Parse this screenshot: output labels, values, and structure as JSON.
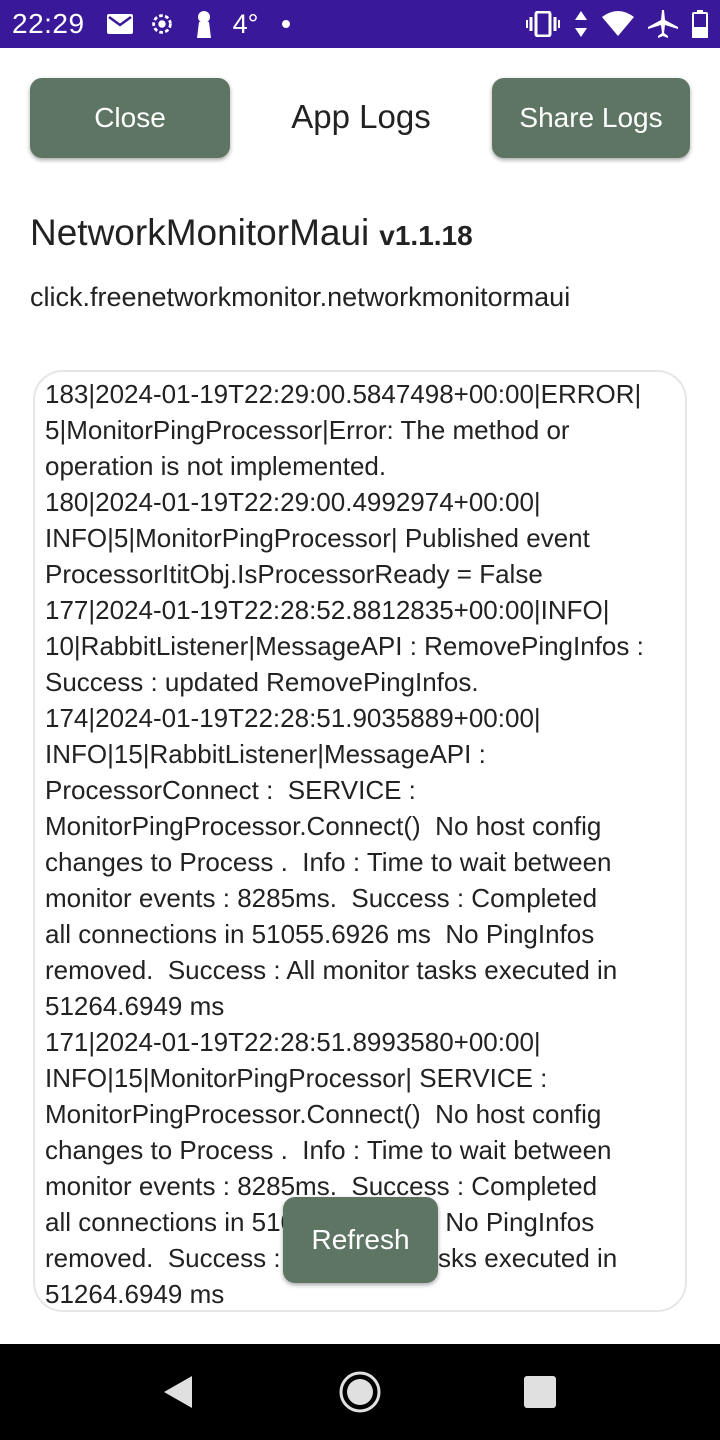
{
  "status_bar": {
    "time": "22:29",
    "temperature": "4°",
    "left_icons": [
      "mail-icon",
      "settings-cog-icon",
      "keyhole-icon"
    ],
    "right_icons": [
      "vibrate-icon",
      "data-arrows-icon",
      "wifi-icon",
      "airplane-icon",
      "battery-icon"
    ],
    "background_color": "#3a189a"
  },
  "header": {
    "close_label": "Close",
    "title": "App Logs",
    "share_label": "Share Logs",
    "button_color": "#5e7563"
  },
  "app_info": {
    "name": "NetworkMonitorMaui",
    "version": "v1.1.18",
    "package": "click.freenetworkmonitor.networkmonitormaui"
  },
  "logs": {
    "text": "183|2024-01-19T22:29:00.5847498+00:00|ERROR|\n5|MonitorPingProcessor|Error: The method or\noperation is not implemented.\n180|2024-01-19T22:29:00.4992974+00:00|\nINFO|5|MonitorPingProcessor| Published event\nProcessorItitObj.IsProcessorReady = False\n177|2024-01-19T22:28:52.8812835+00:00|INFO|\n10|RabbitListener|MessageAPI : RemovePingInfos :\nSuccess : updated RemovePingInfos.\n174|2024-01-19T22:28:51.9035889+00:00|\nINFO|15|RabbitListener|MessageAPI :\nProcessorConnect :  SERVICE :\nMonitorPingProcessor.Connect()  No host config\nchanges to Process .  Info : Time to wait between\nmonitor events : 8285ms.  Success : Completed\nall connections in 51055.6926 ms  No PingInfos\nremoved.  Success : All monitor tasks executed in\n51264.6949 ms\n171|2024-01-19T22:28:51.8993580+00:00|\nINFO|15|MonitorPingProcessor| SERVICE :\nMonitorPingProcessor.Connect()  No host config\nchanges to Process .  Info : Time to wait between\nmonitor events : 8285ms.  Success : Completed\nall connections in 51055.6926 ms  No PingInfos\nremoved.  Success : All monitor tasks executed in\n51264.6949 ms"
  },
  "refresh_label": "Refresh",
  "nav_bar": {
    "icons": [
      "back-icon",
      "home-icon",
      "recent-apps-icon"
    ]
  }
}
